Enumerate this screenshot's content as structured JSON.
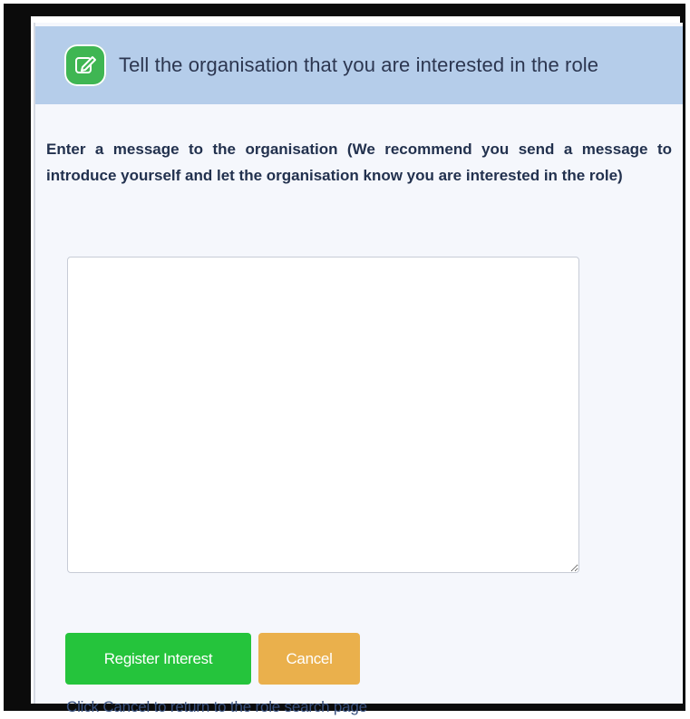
{
  "header": {
    "icon": "edit-icon",
    "title": "Tell the organisation that you are interested in the role"
  },
  "instructions": "Enter a message to the organisation (We recommend you send a message to introduce yourself and let the organisation know you are interested in the role)",
  "message_field": {
    "value": "",
    "placeholder": ""
  },
  "buttons": {
    "register_label": "Register Interest",
    "cancel_label": "Cancel"
  },
  "help_text": "Click Cancel to return to the role search page",
  "colors": {
    "header_bg": "#b5cdea",
    "register_button": "#25c43c",
    "cancel_button": "#eab04c",
    "icon_bg": "#3fb653"
  }
}
